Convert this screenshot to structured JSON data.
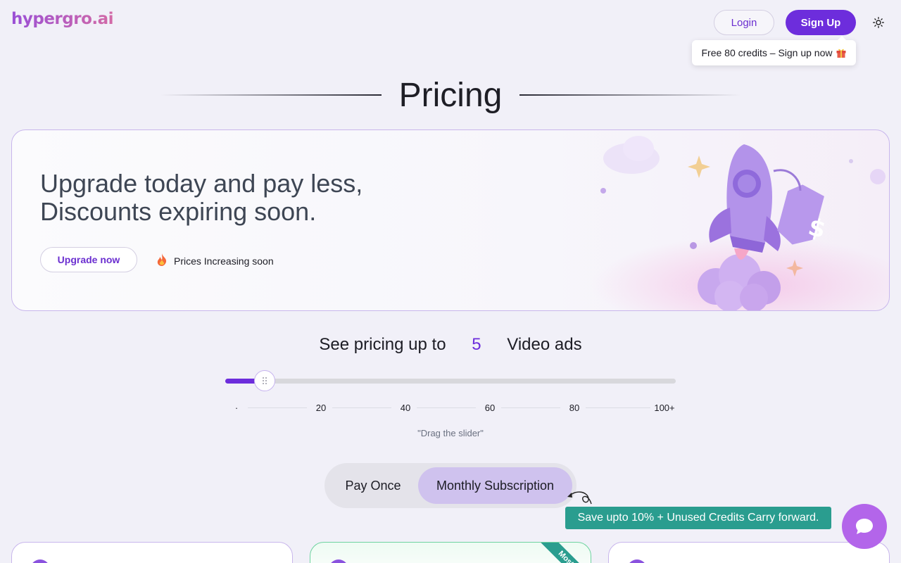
{
  "header": {
    "logo_text": "hypergro.ai",
    "login_label": "Login",
    "signup_label": "Sign Up",
    "promo_text": "Free 80 credits – Sign up now"
  },
  "page_title": "Pricing",
  "banner": {
    "headline_line1": "Upgrade today and pay less,",
    "headline_line2": "Discounts expiring soon.",
    "upgrade_button": "Upgrade now",
    "price_note": "Prices Increasing soon"
  },
  "slider": {
    "prefix": "See pricing up to",
    "value": "5",
    "suffix": "Video ads",
    "min": 0,
    "max": 100,
    "current": 5,
    "ticks": [
      "·",
      "20",
      "40",
      "60",
      "80",
      "100+"
    ],
    "hint": "\"Drag the slider\""
  },
  "billing": {
    "option_once": "Pay Once",
    "option_monthly": "Monthly Subscription",
    "selected": "Monthly Subscription",
    "save_note": "Save upto 10% + Unused Credits Carry forward."
  },
  "cards": {
    "ribbon": "Most"
  },
  "colors": {
    "accent": "#6d2ddc",
    "badge": "#2a9d8f",
    "chat": "#b365ea"
  }
}
